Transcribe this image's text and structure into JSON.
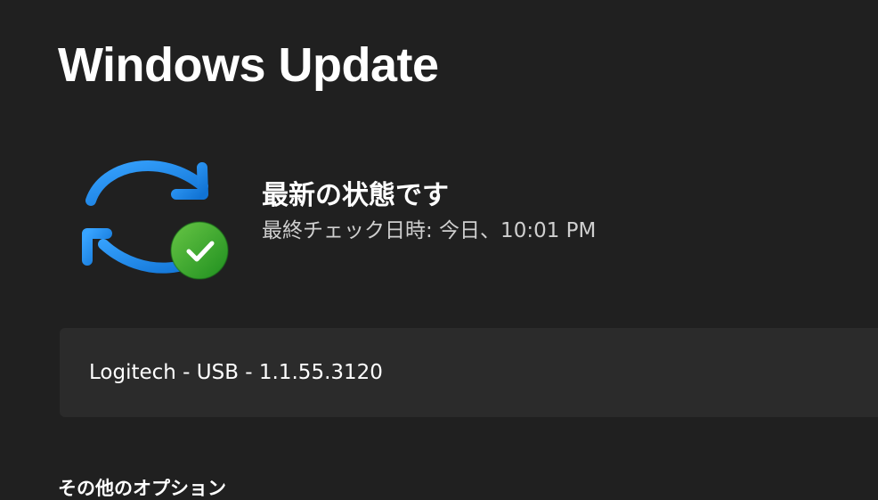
{
  "header": {
    "title": "Windows Update"
  },
  "status": {
    "title": "最新の状態です",
    "last_checked": "最終チェック日時: 今日、10:01 PM",
    "icon": "sync-icon",
    "badge_icon": "checkmark-icon",
    "colors": {
      "sync_icon": "#1e88e5",
      "success_badge": "#2ea043"
    }
  },
  "updates": [
    {
      "label": "Logitech - USB - 1.1.55.3120"
    }
  ],
  "more_options": {
    "heading": "その他のオプション"
  }
}
